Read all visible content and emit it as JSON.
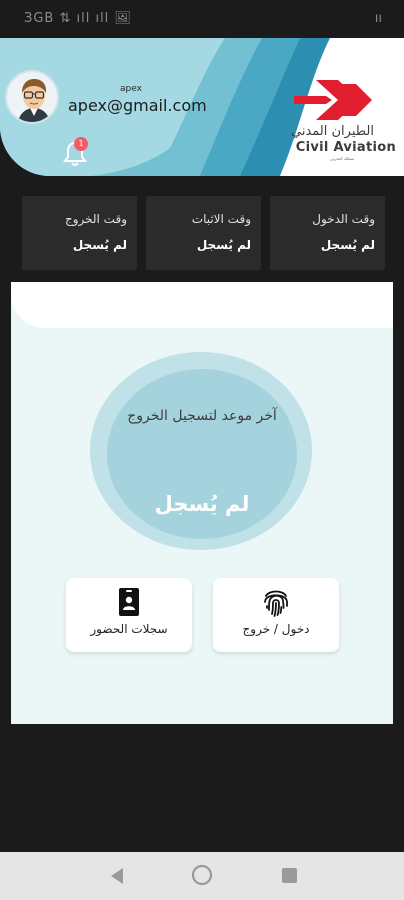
{
  "status_bar": {
    "left": "ЗGB ⇅ ıll ıll 🖼",
    "right": "ıı"
  },
  "user": {
    "name": "apex",
    "email": "apex@gmail.com",
    "notifications": "1"
  },
  "logo": {
    "ar": "الطيران المدني",
    "en": "Civil Aviation",
    "tag": "مملكة البحرين"
  },
  "times": [
    {
      "title": "وقت الدخول",
      "value": "لم يُسجل"
    },
    {
      "title": "وقت الاثبات",
      "value": "لم يُسجل"
    },
    {
      "title": "وقت الخروج",
      "value": "لم يُسجل"
    }
  ],
  "circle": {
    "label": "آخر موعد لتسجيل الخروج",
    "value": "لم يُسجل"
  },
  "actions": {
    "checkin": "دخول / خروج",
    "records": "سجلات الحضور"
  },
  "colors": {
    "accent": "#a5d3dd",
    "logo_red": "#e01e2e",
    "header_blue": "#2c8fb1"
  }
}
